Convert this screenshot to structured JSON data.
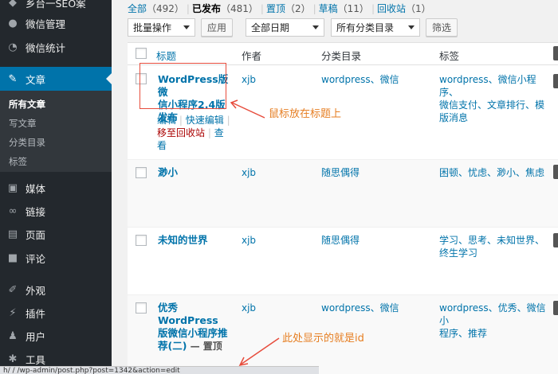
{
  "sidebar": {
    "top_partial": "乡台一SEO案",
    "items": [
      {
        "key": "wechat-manage",
        "label": "微信管理",
        "icon": "chat-icon"
      },
      {
        "key": "wechat-stats",
        "label": "微信统计",
        "icon": "pie-chart-icon"
      },
      {
        "key": "posts",
        "label": "文章",
        "icon": "pin-icon"
      },
      {
        "key": "media",
        "label": "媒体",
        "icon": "media-icon"
      },
      {
        "key": "links",
        "label": "链接",
        "icon": "link-icon"
      },
      {
        "key": "pages",
        "label": "页面",
        "icon": "page-icon"
      },
      {
        "key": "comments",
        "label": "评论",
        "icon": "comment-icon"
      },
      {
        "key": "appearance",
        "label": "外观",
        "icon": "brush-icon"
      },
      {
        "key": "plugins",
        "label": "插件",
        "icon": "plug-icon"
      },
      {
        "key": "users",
        "label": "用户",
        "icon": "user-icon"
      },
      {
        "key": "tools",
        "label": "工具",
        "icon": "wrench-icon"
      }
    ],
    "submenu": [
      "所有文章",
      "写文章",
      "分类目录",
      "标签"
    ]
  },
  "filters": {
    "all": "全部",
    "all_count": "（492）",
    "published": "已发布",
    "published_count": "（481）",
    "sticky": "置顶",
    "sticky_count": "（2）",
    "drafts": "草稿",
    "drafts_count": "（11）",
    "trash": "回收站",
    "trash_count": "（1）",
    "sep": "|"
  },
  "toolbar": {
    "bulk_action": "批量操作",
    "apply": "应用",
    "date_filter": "全部日期",
    "category_filter": "所有分类目录",
    "filter_button": "筛选"
  },
  "table": {
    "headers": {
      "title": "标题",
      "author": "作者",
      "categories": "分类目录",
      "tags": "标签"
    },
    "rows": [
      {
        "title_lines": [
          "WordPress版微",
          "信小程序2.4版",
          "发布"
        ],
        "author": "xjb",
        "categories": "wordpress、微信",
        "tags_lines": [
          "wordpress、微信小程序、",
          "微信支付、文章排行、模",
          "版消息"
        ],
        "actions": {
          "edit": "编辑",
          "quick_edit": "快速编辑",
          "trash": "移至回收站",
          "view_1": "查",
          "view_2": "看",
          "bar": "|"
        }
      },
      {
        "title_lines": [
          "渺小"
        ],
        "author": "xjb",
        "categories": "随思偶得",
        "tags_lines": [
          "困顿、忧虑、渺小、焦虑"
        ]
      },
      {
        "title_lines": [
          "未知的世界"
        ],
        "author": "xjb",
        "categories": "随思偶得",
        "tags_lines": [
          "学习、思考、未知世界、",
          "终生学习"
        ]
      },
      {
        "title_lines": [
          "优秀WordPress",
          "版微信小程序推",
          "荐(二)"
        ],
        "sticky_label": " — 置顶",
        "author": "xjb",
        "categories": "wordpress、微信",
        "tags_lines": [
          "wordpress、优秀、微信小",
          "程序、推荐"
        ]
      }
    ]
  },
  "annotations": {
    "hover_title": "鼠标放在标题上",
    "id_hint": "此处显示的就是id"
  },
  "statusbar": {
    "text": "h/   /     /wp-admin/post.php?post=1342&action=edit"
  },
  "colors": {
    "accent": "#0073aa",
    "sidebar_bg": "#23282d",
    "annotation": "#e67e22",
    "highlight": "#e74c3c"
  }
}
